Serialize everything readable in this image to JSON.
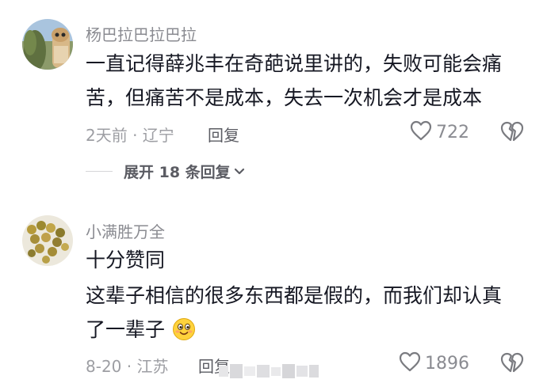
{
  "comments": [
    {
      "username": "杨巴拉巴拉巴拉",
      "text_lines": [
        "一直记得薛兆丰在奇葩说里讲的，失败可能会痛",
        "苦，但痛苦不是成本，失去一次机会才是成本"
      ],
      "time_location": "2天前 · 辽宁",
      "reply_label": "回复",
      "like_count": "722",
      "expand_label": "展开 18 条回复"
    },
    {
      "username": "小满胜万全",
      "text_lines": [
        "十分赞同",
        "这辈子相信的很多东西都是假的，而我们却认真",
        "了一辈子"
      ],
      "time_location": "8-20 · 江苏",
      "reply_label": "回复",
      "like_count": "1896"
    }
  ],
  "icons": {
    "like": "heart-outline-icon",
    "dislike": "broken-heart-icon",
    "expand": "chevron-down-icon",
    "emoji": "smiling-face-emoji"
  }
}
